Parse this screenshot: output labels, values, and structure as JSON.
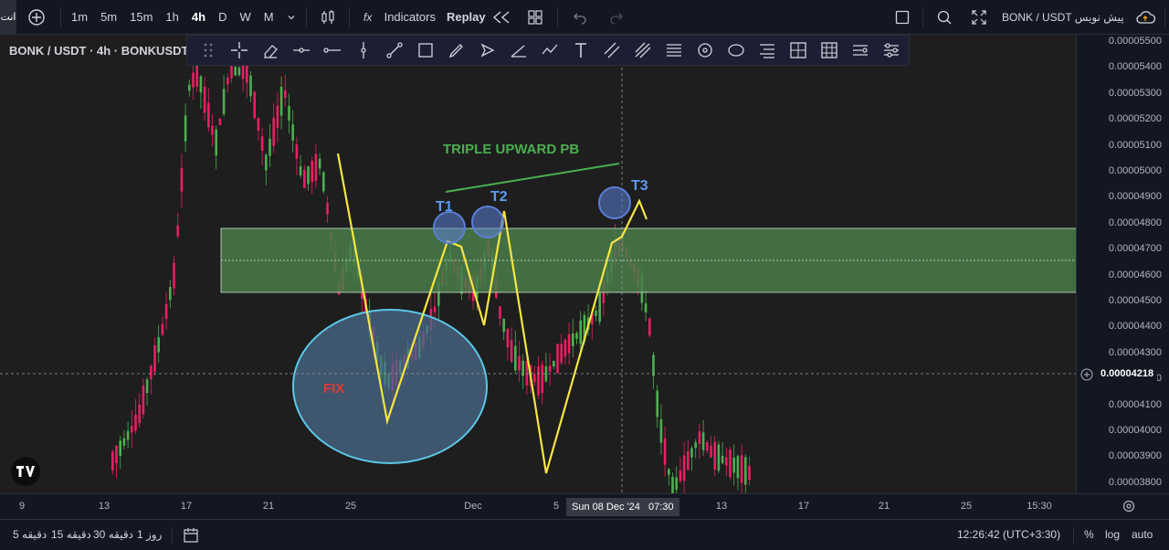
{
  "toolbar": {
    "add_symbol_icon": "plus-circle-icon",
    "intervals": [
      "1m",
      "5m",
      "15m",
      "1h",
      "4h",
      "D",
      "W",
      "M"
    ],
    "active_interval": "4h",
    "indicators_label": "Indicators",
    "replay_label": "Replay",
    "right_symbol": "BONK / USDT پیش نویس",
    "corner_label": "انت"
  },
  "legend": {
    "symbol_line": "BONK / USDT · 4h · BONKUSDT"
  },
  "price_axis": {
    "labels": [
      "0.00005500",
      "0.00005400",
      "0.00005300",
      "0.00005200",
      "0.00005100",
      "0.00005000",
      "0.00004900",
      "0.00004800",
      "0.00004700",
      "0.00004600",
      "0.00004500",
      "0.00004400",
      "0.00004300",
      "0.00004200",
      "0.00004100",
      "0.00004000",
      "0.00003900",
      "0.00003800"
    ],
    "current_price": "0.00004218"
  },
  "time_axis": {
    "labels": [
      "9",
      "13",
      "17",
      "21",
      "25",
      "Dec",
      "5",
      "13",
      "17",
      "21",
      "25",
      "15:30"
    ],
    "crosshair_label": "Sun 08 Dec '24   07:30"
  },
  "annotations": {
    "title": "TRIPLE UPWARD PB",
    "t1": "T1",
    "t2": "T2",
    "t3": "T3",
    "fix": "FIX",
    "colors": {
      "title": "#4caf50",
      "zone": "#4a7d4a",
      "zigzag": "#f5e642",
      "circle": "#5b7fd6",
      "fix_text": "#e53935",
      "ellipse_fill": "#4a6a8a",
      "ellipse_stroke": "#5bc8e8"
    }
  },
  "bottom_bar": {
    "ranges": [
      "5 دقیقه",
      "15 دقیقه",
      "30 دقیقه",
      "1 روز"
    ],
    "clock": "12:26:42 (UTC+3:30)",
    "percent": "%",
    "log": "log",
    "auto": "auto"
  },
  "colors": {
    "bull": "#4caf50",
    "bear": "#e91e63",
    "background": "#1e1e1e"
  }
}
